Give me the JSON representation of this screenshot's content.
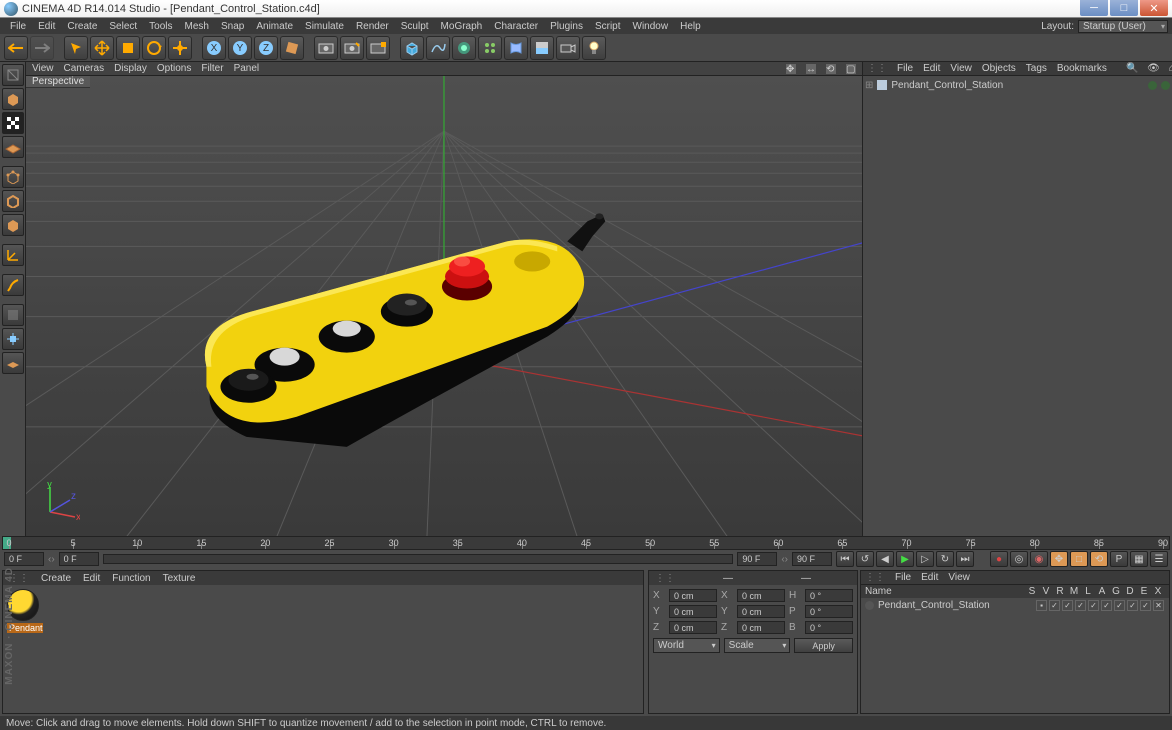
{
  "title": "CINEMA 4D R14.014 Studio - [Pendant_Control_Station.c4d]",
  "menus": [
    "File",
    "Edit",
    "Create",
    "Select",
    "Tools",
    "Mesh",
    "Snap",
    "Animate",
    "Simulate",
    "Render",
    "Sculpt",
    "MoGraph",
    "Character",
    "Plugins",
    "Script",
    "Window",
    "Help"
  ],
  "layout_label": "Layout:",
  "layout_value": "Startup (User)",
  "view_menus": [
    "View",
    "Cameras",
    "Display",
    "Options",
    "Filter",
    "Panel"
  ],
  "view_name": "Perspective",
  "obj_menus": [
    "File",
    "Edit",
    "View",
    "Objects",
    "Tags",
    "Bookmarks"
  ],
  "tree_item": "Pendant_Control_Station",
  "timeline_ticks": [
    0,
    5,
    10,
    15,
    20,
    25,
    30,
    35,
    40,
    45,
    50,
    55,
    60,
    65,
    70,
    75,
    80,
    85,
    90
  ],
  "tl_start": "0 F",
  "tl_end": "90 F",
  "tl_cur": "0 F",
  "tl_end2": "0 F",
  "mat_menus": [
    "Create",
    "Edit",
    "Function",
    "Texture"
  ],
  "mat_name": "Pendant",
  "coord_hdrs": [
    "—",
    "—",
    "—"
  ],
  "coords": {
    "X": "0 cm",
    "X2": "0 cm",
    "H": "0 °",
    "Y": "0 cm",
    "Y2": "0 cm",
    "P": "0 °",
    "Z": "0 cm",
    "Z2": "0 cm",
    "B": "0 °"
  },
  "coord_sel1": "World",
  "coord_sel2": "Scale",
  "coord_apply": "Apply",
  "attr_menus": [
    "File",
    "Edit",
    "View"
  ],
  "attr_cols_name": "Name",
  "attr_cols": [
    "S",
    "V",
    "R",
    "M",
    "L",
    "A",
    "G",
    "D",
    "E",
    "X"
  ],
  "attr_obj": "Pendant_Control_Station",
  "status": "Move: Click and drag to move elements. Hold down SHIFT to quantize movement / add to the selection in point mode, CTRL to remove.",
  "logo": "MAXON · CINEMA 4D"
}
